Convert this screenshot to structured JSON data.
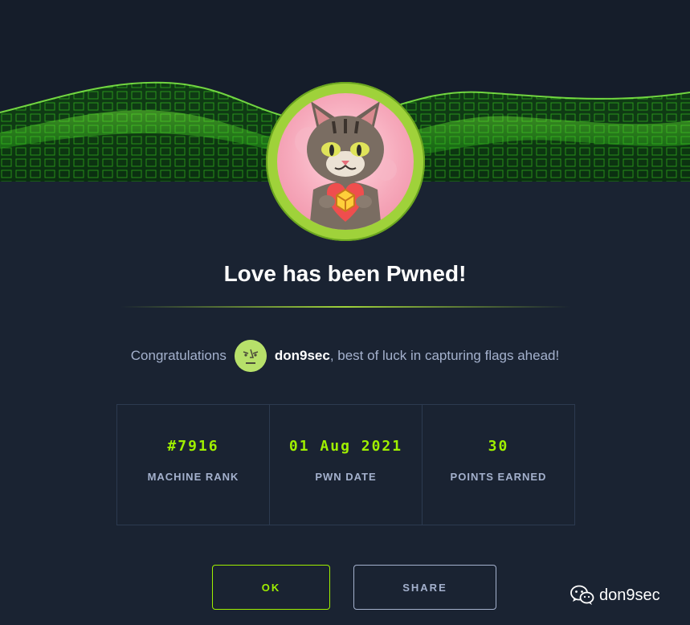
{
  "title": "Love has been Pwned!",
  "message": {
    "prefix": "Congratulations",
    "username": "don9sec",
    "suffix": ", best of luck in capturing flags ahead!"
  },
  "stats": [
    {
      "value": "#7916",
      "label": "MACHINE RANK"
    },
    {
      "value": "01 Aug 2021",
      "label": "PWN DATE"
    },
    {
      "value": "30",
      "label": "POINTS EARNED"
    }
  ],
  "buttons": {
    "ok_label": "OK",
    "share_label": "SHARE"
  },
  "watermark": {
    "text": "don9sec",
    "icon": "wechat-icon"
  },
  "colors": {
    "accent": "#9fef00",
    "background": "#1a2332",
    "text_muted": "#a4b1cd",
    "avatar_ring": "#9fd23a"
  }
}
